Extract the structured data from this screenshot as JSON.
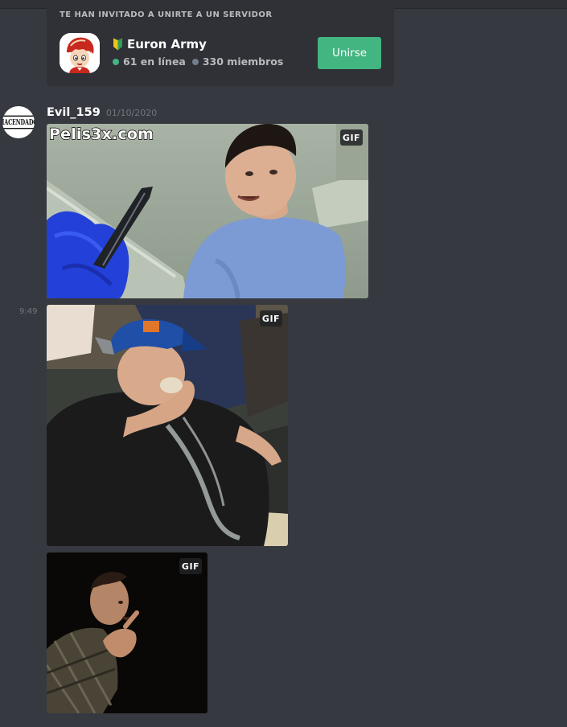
{
  "invite": {
    "header": "TE HAN INVITADO A UNIRTE A UN SERVIDOR",
    "server_name": "Euron Army",
    "online": "61 en línea",
    "members": "330 miembros",
    "join_label": "Unirse",
    "icons": {
      "server_icon": "anime-character-red-hat",
      "badge": "beginner-leaf-icon"
    },
    "colors": {
      "join_button": "#43b581",
      "online_dot": "#43b581",
      "members_dot": "#747f8d"
    }
  },
  "message": {
    "username": "Evil_159",
    "date": "01/10/2020",
    "avatar_text": "HACENDADO",
    "side_time": "9:49",
    "attachments": [
      {
        "type": "gif",
        "badge": "GIF",
        "watermark": "Pelis3x.com",
        "description_icon": "gif-man-knife"
      },
      {
        "type": "gif",
        "badge": "GIF",
        "description_icon": "gif-man-cap-stadium"
      },
      {
        "type": "gif",
        "badge": "GIF",
        "description_icon": "gif-man-dark"
      }
    ]
  }
}
